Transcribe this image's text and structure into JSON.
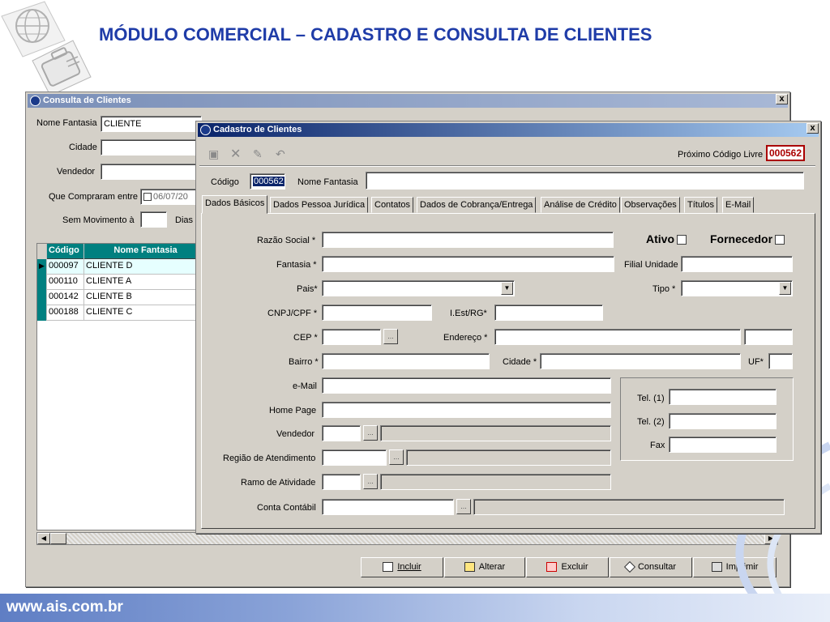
{
  "slide": {
    "title": "MÓDULO COMERCIAL – CADASTRO E CONSULTA DE CLIENTES",
    "footer": "www.ais.com.br",
    "globe_icon": "globe-icon",
    "suitcase_icon": "suitcase-icon"
  },
  "consulta": {
    "title": "Consulta de Clientes",
    "close": "x",
    "nome_fantasia_label": "Nome Fantasia",
    "nome_fantasia_value": "CLIENTE",
    "cidade_label": "Cidade",
    "vendedor_label": "Vendedor",
    "que_compraram_label": "Que Compraram entre",
    "que_compraram_date": "06/07/20",
    "sem_movimento_label": "Sem Movimento à",
    "dias_label": "Dias",
    "grid": {
      "headers": [
        "Código",
        "Nome Fantasia"
      ],
      "rows": [
        {
          "codigo": "000097",
          "nome": "CLIENTE D"
        },
        {
          "codigo": "000110",
          "nome": "CLIENTE A"
        },
        {
          "codigo": "000142",
          "nome": "CLIENTE B"
        },
        {
          "codigo": "000188",
          "nome": "CLIENTE C"
        }
      ]
    },
    "buttons": {
      "incluir": "Incluir",
      "alterar": "Alterar",
      "excluir": "Excluir",
      "consultar": "Consultar",
      "imprimir": "Imprimir"
    }
  },
  "cadastro": {
    "title": "Cadastro de Clientes",
    "close": "x",
    "proximo_label": "Próximo Código Livre",
    "proximo_value": "000562",
    "codigo_label": "Código",
    "codigo_value": "000562",
    "nome_fantasia_label": "Nome Fantasia",
    "tabs": [
      "Dados Básicos",
      "Dados Pessoa Jurídica",
      "Contatos",
      "Dados de Cobrança/Entrega",
      "Análise de Crédito",
      "Observações",
      "Títulos",
      "E-Mail"
    ],
    "fields": {
      "razao_social": "Razão Social *",
      "ativo": "Ativo",
      "fornecedor": "Fornecedor",
      "fantasia": "Fantasia *",
      "filial_unidade": "Filial Unidade",
      "pais": "Pais*",
      "tipo": "Tipo *",
      "cnpj_cpf": "CNPJ/CPF *",
      "iest_rg": "I.Est/RG*",
      "cep": "CEP *",
      "endereco": "Endereço *",
      "bairro": "Bairro *",
      "cidade": "Cidade *",
      "uf": "UF*",
      "email": "e-Mail",
      "home_page": "Home Page",
      "vendedor": "Vendedor",
      "regiao": "Região de Atendimento",
      "ramo": "Ramo de Atividade",
      "conta_contabil": "Conta Contábil",
      "tel1": "Tel. (1)",
      "tel2": "Tel. (2)",
      "fax": "Fax"
    },
    "dots": "...",
    "dropdown_arrow": "▼"
  }
}
